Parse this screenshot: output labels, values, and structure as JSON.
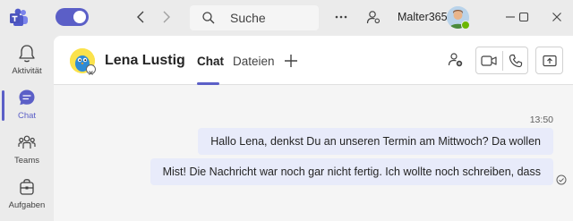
{
  "titlebar": {
    "logo_icon": "teams-logo-icon",
    "toggle_on": true,
    "search_placeholder": "Suche",
    "org_name": "Malter365",
    "icons": [
      "chevron-left-icon",
      "chevron-right-icon",
      "more-icon",
      "people-settings-icon",
      "minimize-icon",
      "maximize-icon",
      "close-icon"
    ],
    "presence_color": "#6bb700"
  },
  "rail": {
    "items": [
      {
        "label": "Aktivität",
        "icon": "bell-icon",
        "active": false
      },
      {
        "label": "Chat",
        "icon": "chat-icon",
        "active": true
      },
      {
        "label": "Teams",
        "icon": "teams-icon",
        "active": false
      },
      {
        "label": "Aufgaben",
        "icon": "tasks-icon",
        "active": false
      }
    ],
    "accent": "#5b5fc7"
  },
  "chat": {
    "contact_name": "Lena Lustig",
    "tabs": [
      {
        "label": "Chat",
        "active": true
      },
      {
        "label": "Dateien",
        "active": false
      }
    ],
    "header_icons": [
      "add-tab-icon",
      "add-people-icon",
      "video-call-icon",
      "phone-call-icon",
      "share-screen-icon"
    ],
    "timestamp": "13:50",
    "messages": [
      {
        "text": "Hallo Lena, denkst Du an unseren Termin am Mittwoch? Da wollen"
      },
      {
        "text": "Mist! Die Nachricht war noch gar nicht fertig. Ich wollte noch schreiben, dass"
      }
    ],
    "bubble_color": "#e8ebfa"
  }
}
